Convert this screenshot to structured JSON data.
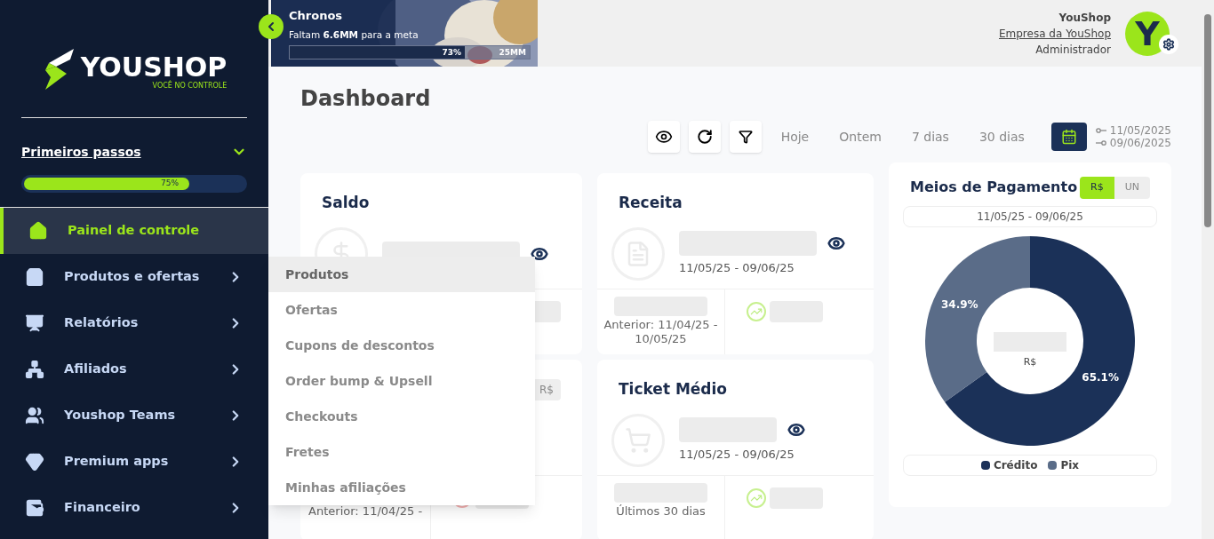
{
  "sidebar": {
    "brand": "YOUSHOP",
    "tagline": "VOCÊ NO CONTROLE",
    "onboarding": {
      "title": "Primeiros passos",
      "level": 0.75,
      "reading": "75%",
      "expanded": true
    },
    "items": [
      {
        "label": "Painel de controle",
        "selected": true,
        "has_submenu": false
      },
      {
        "label": "Produtos e ofertas",
        "selected": false,
        "has_submenu": true
      },
      {
        "label": "Relatórios",
        "selected": false,
        "has_submenu": true
      },
      {
        "label": "Afiliados",
        "selected": false,
        "has_submenu": true
      },
      {
        "label": "Youshop Teams",
        "selected": false,
        "has_submenu": true
      },
      {
        "label": "Premium apps",
        "selected": false,
        "has_submenu": true
      },
      {
        "label": "Financeiro",
        "selected": false,
        "has_submenu": true
      }
    ]
  },
  "submenu": {
    "items": [
      {
        "label": "Produtos",
        "selected": true
      },
      {
        "label": "Ofertas",
        "selected": false
      },
      {
        "label": "Cupons de descontos",
        "selected": false
      },
      {
        "label": "Order bump & Upsell",
        "selected": false
      },
      {
        "label": "Checkouts",
        "selected": false
      },
      {
        "label": "Fretes",
        "selected": false
      },
      {
        "label": "Minhas afiliações",
        "selected": false
      }
    ]
  },
  "goal_banner": {
    "title": "Chronos",
    "text": "Faltam **6.6MM** para a meta",
    "level": 0.73,
    "reading": "73%",
    "target": "25MM"
  },
  "user": {
    "name": "YouShop",
    "company": "Empresa da YouShop",
    "role": "Administrador",
    "initial": "Y"
  },
  "page_title": "Dashboard",
  "toolbar": {
    "ranges": [
      {
        "label": "Hoje",
        "selected": false
      },
      {
        "label": "Ontem",
        "selected": false
      },
      {
        "label": "7 dias",
        "selected": false
      },
      {
        "label": "30 dias",
        "selected": false
      }
    ],
    "date_from": "11/05/2025",
    "date_to": "09/06/2025"
  },
  "cards": [
    {
      "title": "Saldo"
    },
    {
      "title": "Receita",
      "date": "11/05/25 - 09/06/25",
      "previous": "Anterior: 11/04/25 - 10/05/25"
    },
    {
      "toggle": "R$",
      "previous": "Anterior: 11/04/25 -"
    },
    {
      "title": "Ticket Médio",
      "date": "11/05/25 - 09/06/25",
      "previous": "Últimos 30 dias"
    }
  ],
  "payments": {
    "title": "Meios de Pagamento",
    "units": [
      {
        "label": "R$",
        "selected": true
      },
      {
        "label": "UN",
        "selected": false
      }
    ],
    "date": "11/05/25 - 09/06/25",
    "center_label": "R$",
    "chart_data": {
      "type": "donut",
      "categories": [
        "Crédito",
        "Pix"
      ],
      "values": [
        65.1,
        34.9
      ],
      "value_labels": [
        "65.1%",
        "34.9%"
      ]
    },
    "legend": [
      {
        "color": "#1b3158"
      },
      {
        "color": "#5a6c88"
      }
    ]
  }
}
